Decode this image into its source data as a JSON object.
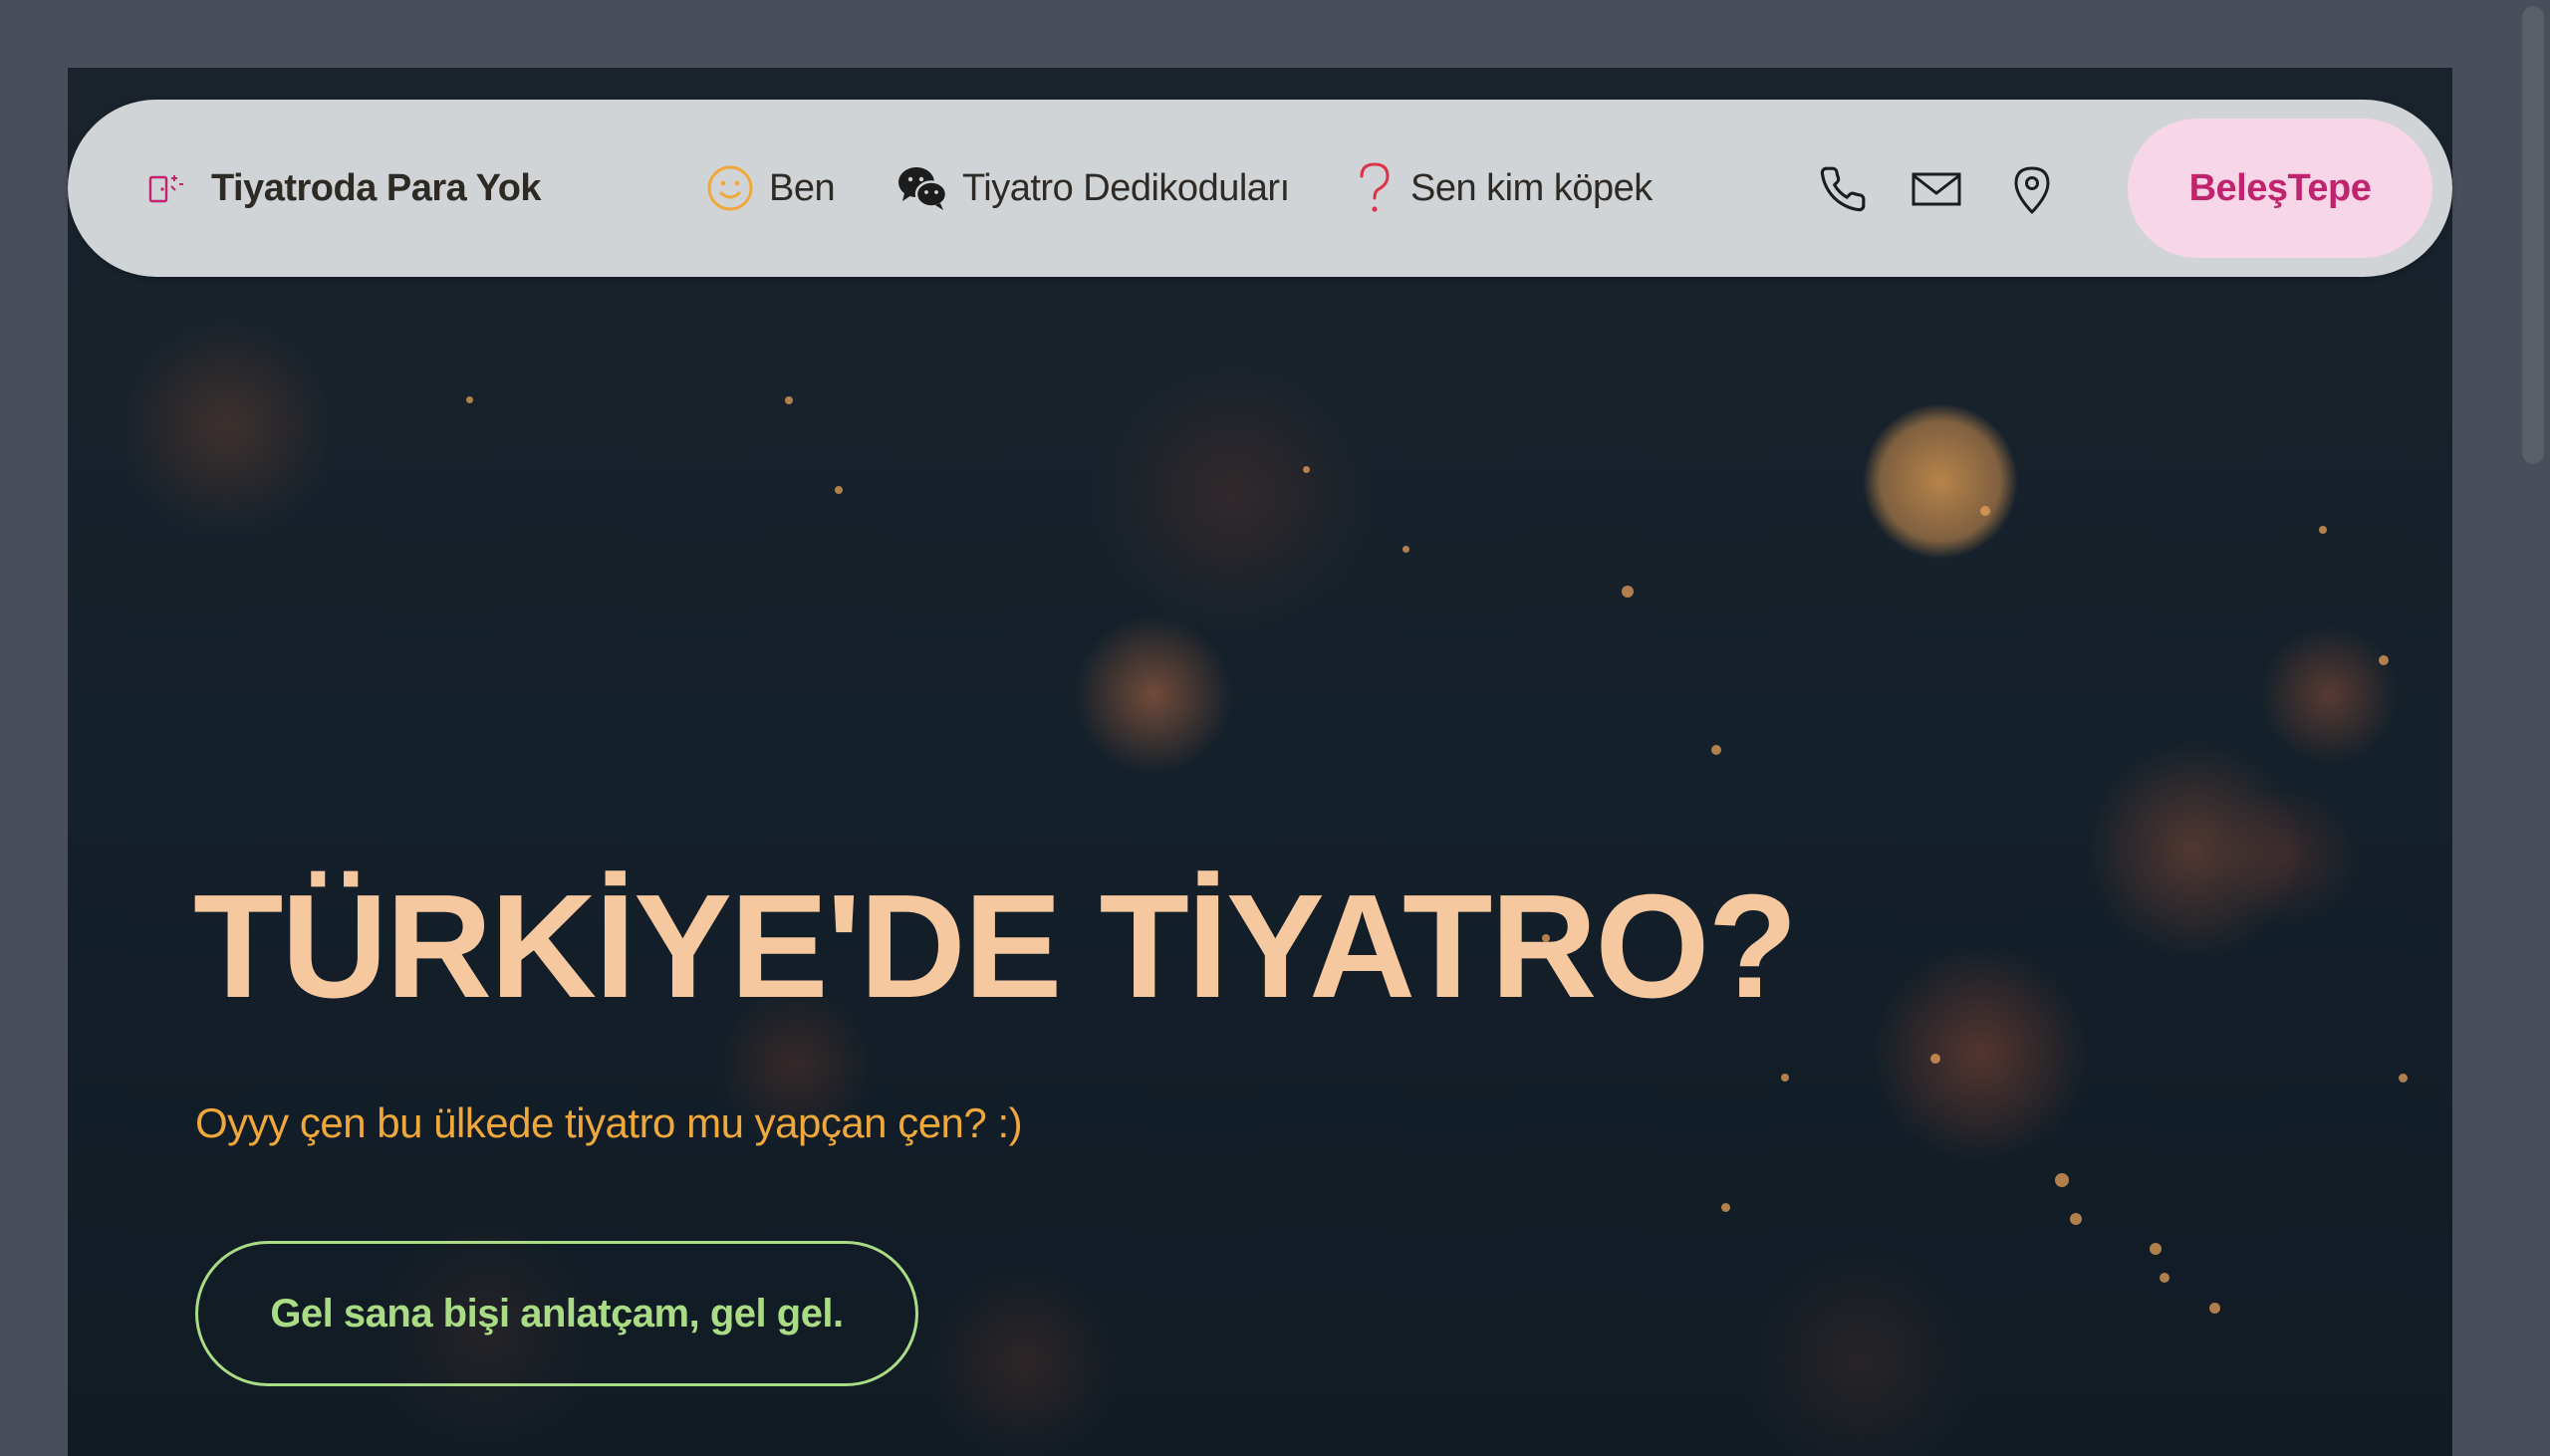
{
  "nav": {
    "brand": "Tiyatroda Para Yok",
    "items": [
      {
        "label": "Ben",
        "icon": "smiley-icon"
      },
      {
        "label": "Tiyatro Dedikoduları",
        "icon": "wechat-icon"
      },
      {
        "label": "Sen kim köpek",
        "icon": "question-icon"
      }
    ],
    "contact_icons": [
      "phone-icon",
      "mail-icon",
      "location-pin-icon"
    ],
    "cta_label": "BeleşTepe"
  },
  "hero": {
    "title": "TÜRKİYE'DE TİYATRO?",
    "subtitle": "Oyyy çen bu ülkede tiyatro mu yapçan çen? :)",
    "cta_label": "Gel sana bişi anlatçam, gel gel."
  },
  "colors": {
    "brand_icon": "#c0246e",
    "smiley": "#f0a83c",
    "question": "#e0314a",
    "cta_top_bg": "#f7d6e8",
    "cta_top_text": "#c0246e",
    "hero_title": "#f6c8a0",
    "hero_subtitle": "#f0a83c",
    "hero_cta": "#a9dc85"
  }
}
